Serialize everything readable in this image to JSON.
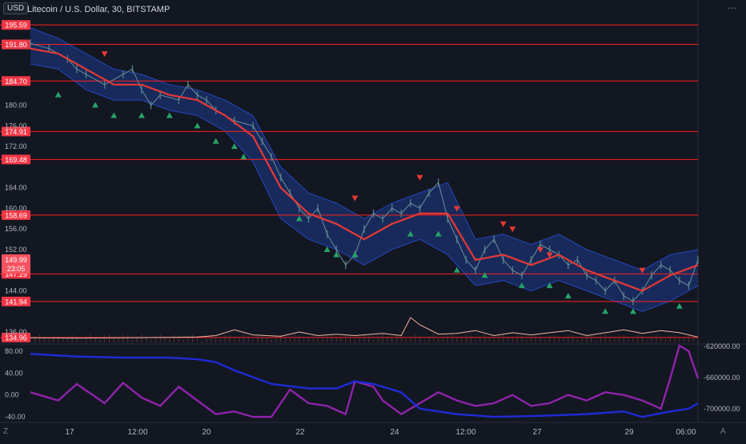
{
  "header": {
    "currency_badge": "USD",
    "title": "Litecoin / U.S. Dollar, 30, BITSTAMP",
    "menu_icon": "ellipsis-icon"
  },
  "colors": {
    "background": "#131722",
    "level_line": "#ff1f1f",
    "ma_line": "#e53935",
    "band_fill": "#1e3a8a",
    "buy_marker": "#26a269",
    "sell_marker": "#e53935",
    "volume_line": "#f5b7a0",
    "osc_purple": "#8e24aa",
    "osc_blue": "#1e2bd6"
  },
  "chart_data": [
    {
      "type": "line",
      "title": "Litecoin / U.S. Dollar, 30, BITSTAMP",
      "x_ticks": [
        "17",
        "12:00",
        "20",
        "22",
        "24",
        "12:00",
        "27",
        "29",
        "06:00"
      ],
      "y_ticks": [
        "180.00",
        "176.00",
        "172.00",
        "164.00",
        "160.00",
        "156.00",
        "152.00",
        "144.00",
        "136.00"
      ],
      "ylim": [
        134,
        197
      ],
      "level_lines": [
        {
          "label": "195.59",
          "value": 195.59
        },
        {
          "label": "191.80",
          "value": 191.8
        },
        {
          "label": "184.70",
          "value": 184.7
        },
        {
          "label": "174.91",
          "value": 174.91
        },
        {
          "label": "169.48",
          "value": 169.48
        },
        {
          "label": "158.69",
          "value": 158.69
        },
        {
          "label": "147.29",
          "value": 147.29
        },
        {
          "label": "141.94",
          "value": 141.94
        },
        {
          "label": "134.96",
          "value": 134.96
        }
      ],
      "current_price": {
        "label": "149.99",
        "countdown": "23:05"
      },
      "price_series": [
        [
          0,
          192
        ],
        [
          2,
          191
        ],
        [
          4,
          189
        ],
        [
          5,
          187
        ],
        [
          6,
          186
        ],
        [
          8,
          184
        ],
        [
          10,
          186
        ],
        [
          11,
          187
        ],
        [
          12,
          183
        ],
        [
          13,
          180
        ],
        [
          14,
          182
        ],
        [
          16,
          181
        ],
        [
          17,
          184
        ],
        [
          18,
          182
        ],
        [
          19,
          181
        ],
        [
          20,
          179
        ],
        [
          22,
          177
        ],
        [
          24,
          176
        ],
        [
          25,
          173
        ],
        [
          26,
          170
        ],
        [
          27,
          166
        ],
        [
          28,
          163
        ],
        [
          29,
          160
        ],
        [
          30,
          158
        ],
        [
          31,
          160
        ],
        [
          32,
          155
        ],
        [
          33,
          152
        ],
        [
          34,
          149
        ],
        [
          35,
          151
        ],
        [
          36,
          156
        ],
        [
          37,
          159
        ],
        [
          38,
          158
        ],
        [
          39,
          160
        ],
        [
          40,
          159
        ],
        [
          41,
          161
        ],
        [
          42,
          160
        ],
        [
          43,
          163
        ],
        [
          44,
          165
        ],
        [
          45,
          158
        ],
        [
          46,
          154
        ],
        [
          47,
          150
        ],
        [
          48,
          148
        ],
        [
          49,
          152
        ],
        [
          50,
          154
        ],
        [
          51,
          150
        ],
        [
          52,
          148
        ],
        [
          53,
          147
        ],
        [
          54,
          150
        ],
        [
          55,
          153
        ],
        [
          56,
          152
        ],
        [
          57,
          151
        ],
        [
          58,
          149
        ],
        [
          59,
          150
        ],
        [
          60,
          147
        ],
        [
          61,
          146
        ],
        [
          62,
          144
        ],
        [
          63,
          146
        ],
        [
          64,
          143
        ],
        [
          65,
          142
        ],
        [
          66,
          144
        ],
        [
          67,
          147
        ],
        [
          68,
          149
        ],
        [
          69,
          148
        ],
        [
          70,
          146
        ],
        [
          71,
          145
        ],
        [
          72,
          150
        ]
      ],
      "ma_series": [
        [
          0,
          191
        ],
        [
          3,
          190
        ],
        [
          6,
          187
        ],
        [
          9,
          184
        ],
        [
          12,
          184
        ],
        [
          15,
          182
        ],
        [
          18,
          181
        ],
        [
          21,
          178
        ],
        [
          24,
          174
        ],
        [
          27,
          164
        ],
        [
          30,
          159
        ],
        [
          33,
          157
        ],
        [
          36,
          154
        ],
        [
          39,
          157
        ],
        [
          42,
          159
        ],
        [
          45,
          159
        ],
        [
          48,
          150
        ],
        [
          51,
          151
        ],
        [
          54,
          149
        ],
        [
          57,
          151
        ],
        [
          60,
          148
        ],
        [
          63,
          146
        ],
        [
          66,
          144
        ],
        [
          69,
          147
        ],
        [
          72,
          149
        ]
      ],
      "band_upper": [
        [
          0,
          195
        ],
        [
          3,
          193
        ],
        [
          6,
          190
        ],
        [
          9,
          187
        ],
        [
          12,
          186
        ],
        [
          15,
          184
        ],
        [
          18,
          183
        ],
        [
          21,
          181
        ],
        [
          24,
          178
        ],
        [
          27,
          168
        ],
        [
          30,
          163
        ],
        [
          33,
          161
        ],
        [
          36,
          158
        ],
        [
          39,
          161
        ],
        [
          42,
          163
        ],
        [
          45,
          165
        ],
        [
          48,
          154
        ],
        [
          51,
          155
        ],
        [
          54,
          153
        ],
        [
          57,
          155
        ],
        [
          60,
          152
        ],
        [
          63,
          150
        ],
        [
          66,
          148
        ],
        [
          69,
          151
        ],
        [
          72,
          152
        ]
      ],
      "band_lower": [
        [
          0,
          188
        ],
        [
          3,
          187
        ],
        [
          6,
          183
        ],
        [
          9,
          181
        ],
        [
          12,
          181
        ],
        [
          15,
          179
        ],
        [
          18,
          178
        ],
        [
          21,
          175
        ],
        [
          24,
          169
        ],
        [
          27,
          158
        ],
        [
          30,
          154
        ],
        [
          33,
          152
        ],
        [
          36,
          149
        ],
        [
          39,
          152
        ],
        [
          42,
          154
        ],
        [
          45,
          151
        ],
        [
          48,
          145
        ],
        [
          51,
          146
        ],
        [
          54,
          144
        ],
        [
          57,
          146
        ],
        [
          60,
          144
        ],
        [
          63,
          142
        ],
        [
          66,
          140
        ],
        [
          69,
          142
        ],
        [
          72,
          145
        ]
      ],
      "buy_markers": [
        [
          3,
          182
        ],
        [
          7,
          180
        ],
        [
          9,
          178
        ],
        [
          12,
          178
        ],
        [
          15,
          178
        ],
        [
          18,
          176
        ],
        [
          20,
          173
        ],
        [
          22,
          172
        ],
        [
          23,
          170
        ],
        [
          29,
          158
        ],
        [
          32,
          152
        ],
        [
          33,
          151
        ],
        [
          35,
          151
        ],
        [
          41,
          155
        ],
        [
          44,
          155
        ],
        [
          46,
          148
        ],
        [
          49,
          147
        ],
        [
          53,
          145
        ],
        [
          56,
          145
        ],
        [
          58,
          143
        ],
        [
          62,
          140
        ],
        [
          65,
          140
        ],
        [
          70,
          141
        ]
      ],
      "sell_markers": [
        [
          8,
          190
        ],
        [
          35,
          162
        ],
        [
          42,
          166
        ],
        [
          46,
          160
        ],
        [
          51,
          157
        ],
        [
          52,
          156
        ],
        [
          55,
          152
        ],
        [
          56,
          151
        ],
        [
          66,
          148
        ]
      ]
    },
    {
      "type": "line",
      "title": "",
      "y_ticks": [
        "80.00",
        "40.00",
        "0.00",
        "-40.00"
      ],
      "right_ticks": [
        "-620000.00",
        "-660000.00",
        "-700000.00"
      ],
      "ylim": [
        -50,
        90
      ],
      "purple_series": [
        [
          0,
          5
        ],
        [
          3,
          -10
        ],
        [
          5,
          20
        ],
        [
          8,
          -15
        ],
        [
          10,
          22
        ],
        [
          12,
          -5
        ],
        [
          14,
          -20
        ],
        [
          16,
          15
        ],
        [
          18,
          -10
        ],
        [
          20,
          -35
        ],
        [
          22,
          -30
        ],
        [
          24,
          -40
        ],
        [
          26,
          -40
        ],
        [
          28,
          10
        ],
        [
          30,
          -15
        ],
        [
          32,
          -20
        ],
        [
          34,
          -35
        ],
        [
          35,
          25
        ],
        [
          37,
          15
        ],
        [
          38,
          -10
        ],
        [
          40,
          -35
        ],
        [
          42,
          -15
        ],
        [
          44,
          5
        ],
        [
          46,
          -10
        ],
        [
          48,
          -20
        ],
        [
          50,
          -15
        ],
        [
          52,
          0
        ],
        [
          54,
          -20
        ],
        [
          56,
          -15
        ],
        [
          58,
          0
        ],
        [
          60,
          -10
        ],
        [
          62,
          5
        ],
        [
          64,
          0
        ],
        [
          66,
          -10
        ],
        [
          68,
          -25
        ],
        [
          69,
          30
        ],
        [
          70,
          90
        ],
        [
          71,
          80
        ],
        [
          72,
          30
        ]
      ],
      "blue_series": [
        [
          0,
          75
        ],
        [
          5,
          70
        ],
        [
          10,
          68
        ],
        [
          15,
          68
        ],
        [
          18,
          65
        ],
        [
          20,
          60
        ],
        [
          22,
          45
        ],
        [
          26,
          20
        ],
        [
          30,
          12
        ],
        [
          33,
          12
        ],
        [
          35,
          25
        ],
        [
          37,
          20
        ],
        [
          40,
          5
        ],
        [
          42,
          -25
        ],
        [
          46,
          -35
        ],
        [
          50,
          -40
        ],
        [
          55,
          -38
        ],
        [
          60,
          -35
        ],
        [
          64,
          -30
        ],
        [
          66,
          -40
        ],
        [
          69,
          -30
        ],
        [
          71,
          -25
        ],
        [
          72,
          -15
        ]
      ],
      "volume_line": [
        [
          0,
          0.2
        ],
        [
          5,
          0.15
        ],
        [
          10,
          0.2
        ],
        [
          15,
          0.25
        ],
        [
          18,
          0.3
        ],
        [
          20,
          0.5
        ],
        [
          22,
          1.3
        ],
        [
          24,
          0.6
        ],
        [
          27,
          0.4
        ],
        [
          29,
          1.0
        ],
        [
          31,
          0.5
        ],
        [
          33,
          0.7
        ],
        [
          35,
          0.5
        ],
        [
          38,
          0.8
        ],
        [
          40,
          0.5
        ],
        [
          41,
          3.0
        ],
        [
          42,
          2.0
        ],
        [
          44,
          0.7
        ],
        [
          46,
          0.8
        ],
        [
          48,
          1.2
        ],
        [
          50,
          0.5
        ],
        [
          52,
          0.9
        ],
        [
          54,
          0.6
        ],
        [
          56,
          0.9
        ],
        [
          58,
          1.2
        ],
        [
          60,
          0.5
        ],
        [
          62,
          0.9
        ],
        [
          64,
          1.3
        ],
        [
          66,
          0.8
        ],
        [
          68,
          1.2
        ],
        [
          70,
          0.9
        ],
        [
          72,
          0.3
        ]
      ]
    }
  ],
  "footer": {
    "left_btn": "Z",
    "right_btn": "A"
  }
}
